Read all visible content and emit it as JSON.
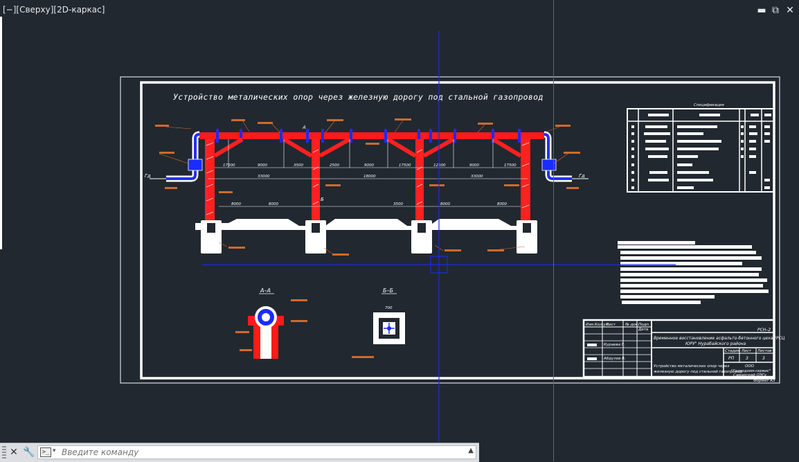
{
  "viewport": {
    "label": "[−][Сверху][2D-каркас]"
  },
  "window_controls": {
    "minimize": "▬",
    "restore": "⧉",
    "close": "✕"
  },
  "drawing": {
    "title": "Устройство металических опор через железную дорогу под стальной газопровод",
    "section_a": "А–А",
    "section_b": "Б–Б",
    "section_mark_a": "А",
    "section_mark_b": "Б",
    "pipe_label_left": "Гд",
    "pipe_label_right": "Гд",
    "dim_total_left": "33000",
    "dim_total_mid": "18000",
    "dim_total_right": "33000",
    "dim_spans": [
      "17500",
      "9000",
      "3500",
      "2500",
      "9000",
      "17500",
      "12500",
      "9000",
      "17500"
    ],
    "dim_lower": [
      "8000",
      "8000",
      "3500",
      "8000",
      "8000"
    ],
    "dim_bb": "700"
  },
  "title_block": {
    "code": "РСН–2",
    "project_line1": "Временное восстановление асфальто-бетонного цеха \"РСЦ",
    "project_line2": "ЮРУ\" Нурабайского района",
    "sheet_title_line1": "Устройство металических опор через",
    "sheet_title_line2": "железную дорогу под стальной газопровод",
    "col_stage": "Стадия",
    "col_sheet": "Лист",
    "col_sheets": "Листов",
    "stage": "РП",
    "sheet": "3",
    "sheets": "3",
    "org_line1": "ООО",
    "org_line2": "\"Газподзем-сервис\"",
    "org_line3": "Самарский ОЭГх",
    "format": "Формат А3",
    "head_cells": [
      "Изм.Кол.уч",
      "Лист",
      "№ док.",
      "Подп.",
      "Дата"
    ],
    "row_person1": "Кураева Г.",
    "row_person2": "Абдулов В."
  },
  "spec_table": {
    "title": "Спецификация"
  },
  "command_line": {
    "placeholder": "Введите команду",
    "close_icon": "✕",
    "settings_icon": "🔧",
    "prompt_icon": ">_",
    "dropdown_icon": "▾",
    "history_icon": "▲"
  },
  "colors": {
    "background": "#212830",
    "pipe": "#ff1a1a",
    "support_blue": "#1a2cff",
    "crosshair": "#1a2ce0",
    "frame": "#ffffff",
    "annotation": "#d06a2a"
  }
}
